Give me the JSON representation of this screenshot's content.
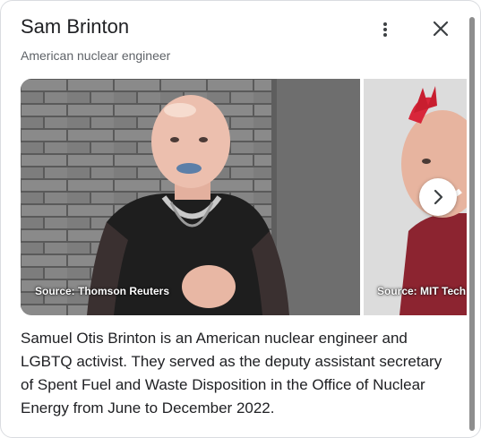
{
  "panel": {
    "title": "Sam Brinton",
    "subtitle": "American nuclear engineer",
    "more_icon": "more-vert-icon",
    "close_icon": "close-icon"
  },
  "images": [
    {
      "source": "Source: Thomson Reuters",
      "accent_color": "#6f6f6f"
    },
    {
      "source": "Source: MIT Tech",
      "accent_color": "#d8263a"
    }
  ],
  "carousel": {
    "next_icon": "chevron-right-icon"
  },
  "description": "Samuel Otis Brinton is an American nuclear engineer and LGBTQ activist. They served as the deputy assistant secretary of Spent Fuel and Waste Disposition in the Office of Nuclear Energy from June to December 2022."
}
